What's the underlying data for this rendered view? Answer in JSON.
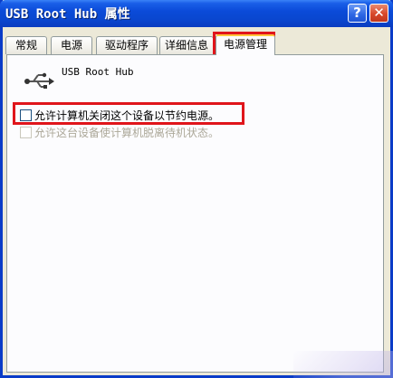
{
  "window": {
    "title": "USB Root Hub 属性",
    "help_glyph": "?",
    "close_glyph": "✕"
  },
  "tabs": [
    {
      "label": "常规"
    },
    {
      "label": "电源"
    },
    {
      "label": "驱动程序"
    },
    {
      "label": "详细信息"
    },
    {
      "label": "电源管理",
      "active": true
    }
  ],
  "device": {
    "name": "USB Root Hub",
    "icon": "usb-icon"
  },
  "options": [
    {
      "label": "允许计算机关闭这个设备以节约电源。",
      "checked": false,
      "enabled": true
    },
    {
      "label": "允许这台设备使计算机脱离待机状态。",
      "checked": false,
      "enabled": false
    }
  ],
  "colors": {
    "highlight": "#e0151b",
    "title_bar": "#0a47d0",
    "active_tab_accent": "#ffc83c"
  }
}
